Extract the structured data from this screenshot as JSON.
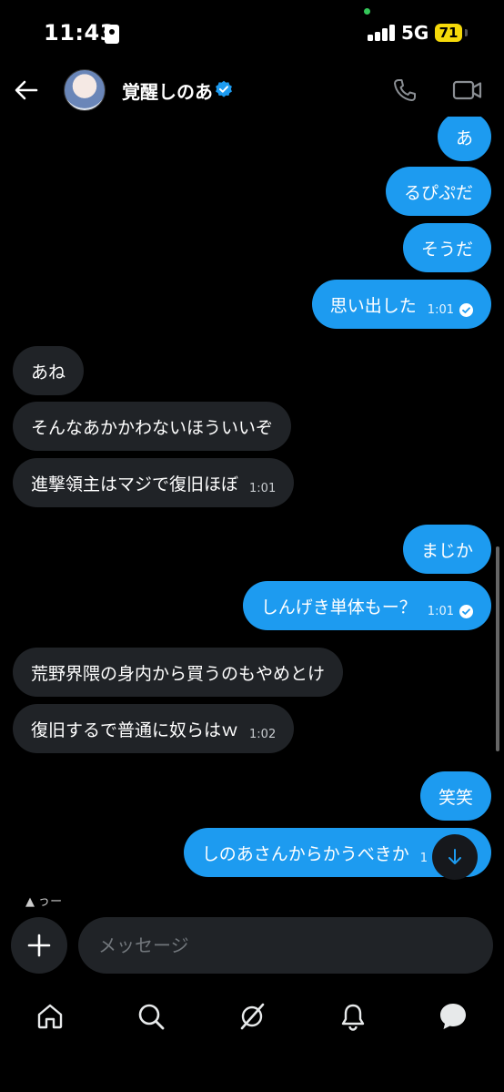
{
  "status_bar": {
    "time": "11:43",
    "network": "5G",
    "battery": "71"
  },
  "header": {
    "name": "覚醒しのあ"
  },
  "messages": [
    {
      "dir": "out",
      "text": "あ",
      "time": ""
    },
    {
      "dir": "out",
      "text": "るぴぷだ",
      "time": ""
    },
    {
      "dir": "out",
      "text": "そうだ",
      "time": ""
    },
    {
      "dir": "out",
      "text": "思い出した",
      "time": "1:01"
    },
    {
      "dir": "in",
      "text": "あね",
      "time": ""
    },
    {
      "dir": "in",
      "text": "そんなあかかわないほういいぞ",
      "time": ""
    },
    {
      "dir": "in",
      "text": "進撃領主はマジで復旧ほぼ",
      "time": "1:01"
    },
    {
      "dir": "out",
      "text": "まじか",
      "time": ""
    },
    {
      "dir": "out",
      "text": "しんげき単体もー？",
      "time": "1:01"
    },
    {
      "dir": "in",
      "text": "荒野界隈の身内から買うのもやめとけ",
      "time": ""
    },
    {
      "dir": "in",
      "text": "復旧するで普通に奴らはｗ",
      "time": "1:02"
    },
    {
      "dir": "out",
      "text": "笑笑",
      "time": ""
    },
    {
      "dir": "out",
      "text": "しのあさんからかうべきか",
      "time": "1"
    }
  ],
  "typing_preview": "うー",
  "composer": {
    "placeholder": "メッセージ"
  },
  "colors": {
    "outgoing": "#1d9bf0",
    "incoming": "#202327",
    "background": "#000000"
  },
  "icons": [
    "back-arrow-icon",
    "verified-badge-icon",
    "phone-icon",
    "video-camera-icon",
    "read-check-icon",
    "scroll-down-icon",
    "plus-icon",
    "home-icon",
    "search-icon",
    "grok-icon",
    "bell-icon",
    "messages-icon"
  ]
}
